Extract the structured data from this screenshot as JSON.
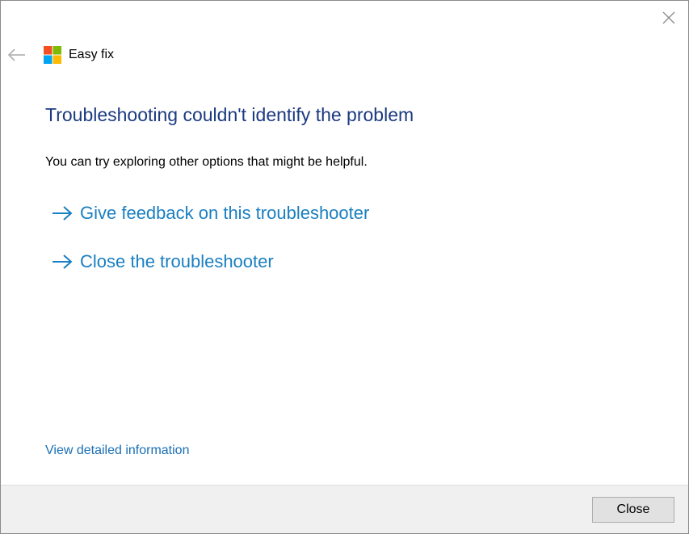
{
  "window": {
    "app_name": "Easy fix",
    "close_icon": "close-icon",
    "back_icon": "back-arrow-icon",
    "logo_icon": "windows-logo-icon",
    "logo_colors": [
      "#f25022",
      "#7fba00",
      "#00a4ef",
      "#ffb900"
    ]
  },
  "main": {
    "heading": "Troubleshooting couldn't identify the problem",
    "subtext": "You can try exploring other options that might be helpful.",
    "options": [
      {
        "label": "Give feedback on this troubleshooter",
        "icon": "arrow-right-icon"
      },
      {
        "label": "Close the troubleshooter",
        "icon": "arrow-right-icon"
      }
    ],
    "details_link": "View detailed information"
  },
  "footer": {
    "close_label": "Close"
  },
  "colors": {
    "heading": "#1b3a80",
    "link": "#1a7fc1",
    "footer_bg": "#f0f0f0"
  }
}
